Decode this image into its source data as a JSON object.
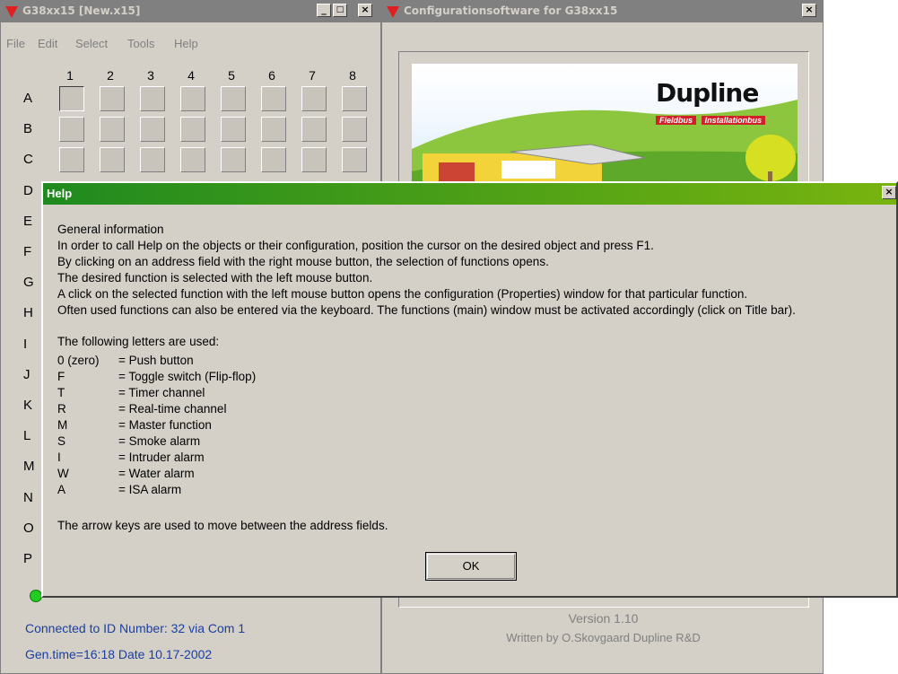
{
  "main_window": {
    "title": "G38xx15 [New.x15]",
    "menu": [
      "File",
      "Edit",
      "Select",
      "Tools",
      "Help"
    ],
    "columns": [
      "1",
      "2",
      "3",
      "4",
      "5",
      "6",
      "7",
      "8"
    ],
    "rows": [
      "A",
      "B",
      "C",
      "D",
      "E",
      "F",
      "G",
      "H",
      "I",
      "J",
      "K",
      "L",
      "M",
      "N",
      "O",
      "P"
    ],
    "status_connected": "Connected to ID Number:  32  via Com  1",
    "status_gentime": "Gen.time=16:18  Date  10.17-2002",
    "status_led_color": "#22cc22"
  },
  "config_window": {
    "title": "Configurationsoftware for G38xx15",
    "logo_brand": "Dupline",
    "logo_tag1": "Fieldbus",
    "logo_tag2": "Installationbus",
    "version": "Version 1.10",
    "author": "Written by O.Skovgaard  Dupline R&D"
  },
  "help_dialog": {
    "title": "Help",
    "lines": [
      "General information",
      "In order to call Help on the objects or their configuration, position the cursor on the desired object and press F1.",
      "By clicking on an address field with the right mouse button, the selection of functions opens.",
      "The desired function is selected with the left mouse button.",
      "A click on the selected function with the left mouse button opens the configuration (Properties) window for that particular function.",
      "Often used functions can also be entered via the keyboard. The functions (main) window must be activated accordingly (click on Title bar)."
    ],
    "letters_intro": "The following letters are used:",
    "letters": [
      {
        "key": "0 (zero)",
        "desc": "= Push button"
      },
      {
        "key": "F",
        "desc": "= Toggle switch (Flip-flop)"
      },
      {
        "key": "T",
        "desc": "= Timer channel"
      },
      {
        "key": "R",
        "desc": "= Real-time channel"
      },
      {
        "key": "M",
        "desc": "= Master function"
      },
      {
        "key": "S",
        "desc": "= Smoke alarm"
      },
      {
        "key": "I",
        "desc": "= Intruder alarm"
      },
      {
        "key": "W",
        "desc": "= Water alarm"
      },
      {
        "key": "A",
        "desc": "= ISA alarm"
      }
    ],
    "footer": "The arrow keys are used to move between the address fields.",
    "ok_label": "OK"
  }
}
